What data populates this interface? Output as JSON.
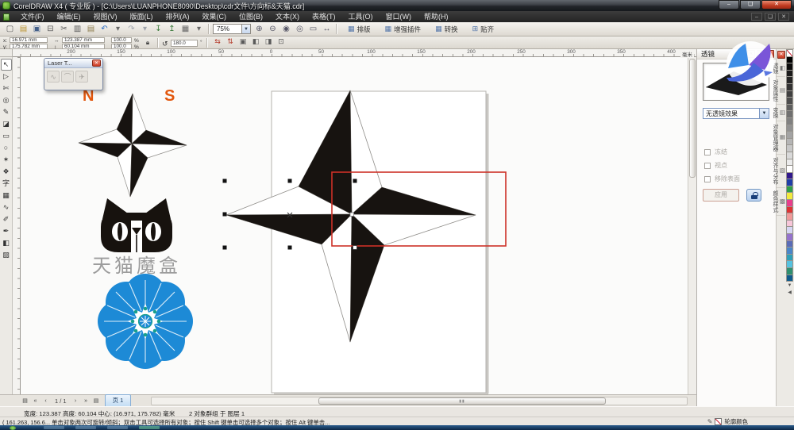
{
  "window": {
    "title": "CorelDRAW X4 ( 专业版 ) - [C:\\Users\\LUANPHONE8090\\Desktop\\cdr文件\\方向标&天猫.cdr]",
    "controls": {
      "minimize": "–",
      "maximize": "❏",
      "close": "✕"
    }
  },
  "menu": {
    "items": [
      "文件(F)",
      "编辑(E)",
      "视图(V)",
      "版面(L)",
      "排列(A)",
      "效果(C)",
      "位图(B)",
      "文本(X)",
      "表格(T)",
      "工具(O)",
      "窗口(W)",
      "帮助(H)"
    ],
    "doc_controls": [
      "‒",
      "❏",
      "✕"
    ]
  },
  "toolbar": {
    "icons": [
      {
        "name": "new-document-icon",
        "glyph": "▢",
        "color": "#5a5a5a"
      },
      {
        "name": "open-icon",
        "glyph": "▤",
        "color": "#b8912e"
      },
      {
        "name": "save-icon",
        "glyph": "▣",
        "color": "#44608a"
      },
      {
        "name": "print-icon",
        "glyph": "⊟",
        "color": "#5a5a5a"
      },
      {
        "name": "cut-icon",
        "glyph": "✂",
        "color": "#555555"
      },
      {
        "name": "copy-icon",
        "glyph": "▥",
        "color": "#555555"
      },
      {
        "name": "paste-icon",
        "glyph": "▤",
        "color": "#8a7a4a"
      },
      {
        "name": "undo-icon",
        "glyph": "↶",
        "color": "#2f6fc4"
      },
      {
        "name": "undo-dropdown-icon",
        "glyph": "▾",
        "color": "#666666"
      },
      {
        "name": "redo-icon",
        "glyph": "↷",
        "color": "#a0a5ad"
      },
      {
        "name": "redo-dropdown-icon",
        "glyph": "▾",
        "color": "#a0a5ad"
      },
      {
        "name": "import-icon",
        "glyph": "↧",
        "color": "#3a7a3a"
      },
      {
        "name": "export-icon",
        "glyph": "↥",
        "color": "#3a7a3a"
      },
      {
        "name": "application-launcher-icon",
        "glyph": "▦",
        "color": "#666666"
      },
      {
        "name": "launcher-dropdown-icon",
        "glyph": "▾",
        "color": "#666666"
      }
    ],
    "zoom_level": "75%",
    "zoom_icons": [
      {
        "name": "zoom-in-icon",
        "glyph": "⊕"
      },
      {
        "name": "zoom-out-icon",
        "glyph": "⊖"
      },
      {
        "name": "zoom-selected-icon",
        "glyph": "◉"
      },
      {
        "name": "zoom-all-objects-icon",
        "glyph": "◎"
      },
      {
        "name": "zoom-page-icon",
        "glyph": "▭"
      },
      {
        "name": "zoom-width-icon",
        "glyph": "↔"
      }
    ],
    "labeled_buttons": [
      {
        "name": "layout-button",
        "icon": "▦",
        "label": "排版"
      },
      {
        "name": "plugins-button",
        "icon": "▦",
        "label": "增强插件"
      },
      {
        "name": "convert-button",
        "icon": "▦",
        "label": "转换"
      },
      {
        "name": "snap-button",
        "icon": "⊞",
        "label": "贴齐"
      }
    ]
  },
  "property_bar": {
    "x_label": "x:",
    "x_value": "16.971 mm",
    "y_label": "y:",
    "y_value": "175.782 mm",
    "width_icon": "↔",
    "width_value": "123.387 mm",
    "height_icon": "↕",
    "height_value": "60.104 mm",
    "scale_x": "100.0",
    "scale_y": "100.0",
    "percent": "%",
    "rotate_icon": "↺",
    "rotation_value": "180.0",
    "rotation_unit": "°",
    "icons": [
      {
        "name": "mirror-horizontal-icon",
        "glyph": "⇆",
        "color": "#b33a2a"
      },
      {
        "name": "mirror-vertical-icon",
        "glyph": "⇅",
        "color": "#b33a2a"
      },
      {
        "name": "combine-icon",
        "glyph": "▣",
        "color": "#5a5a5a"
      },
      {
        "name": "weld-icon",
        "glyph": "◧",
        "color": "#5a5a5a"
      },
      {
        "name": "trim-icon",
        "glyph": "◨",
        "color": "#5a5a5a"
      },
      {
        "name": "wrap-text-icon",
        "glyph": "⊡",
        "color": "#5a5a5a"
      }
    ]
  },
  "rulers": {
    "h_numbers": [
      "200",
      "150",
      "100",
      "50",
      "0",
      "50",
      "100",
      "150",
      "200",
      "250",
      "300",
      "350",
      "400"
    ],
    "unit": "毫米"
  },
  "toolbox": {
    "tools": [
      {
        "name": "pick-tool",
        "glyph": "↖",
        "selected": true
      },
      {
        "name": "shape-tool",
        "glyph": "▷"
      },
      {
        "name": "crop-tool",
        "glyph": "✄"
      },
      {
        "name": "zoom-tool",
        "glyph": "◎"
      },
      {
        "name": "freehand-tool",
        "glyph": "✎"
      },
      {
        "name": "smart-fill-tool",
        "glyph": "◪"
      },
      {
        "name": "rectangle-tool",
        "glyph": "▭"
      },
      {
        "name": "ellipse-tool",
        "glyph": "○"
      },
      {
        "name": "polygon-tool",
        "glyph": "✶"
      },
      {
        "name": "basic-shapes-tool",
        "glyph": "❖"
      },
      {
        "name": "text-tool",
        "glyph": "字"
      },
      {
        "name": "table-tool",
        "glyph": "▦"
      },
      {
        "name": "interactive-blend-tool",
        "glyph": "∿"
      },
      {
        "name": "eyedropper-tool",
        "glyph": "✐"
      },
      {
        "name": "outline-pen-tool",
        "glyph": "✒"
      },
      {
        "name": "fill-tool",
        "glyph": "◧"
      },
      {
        "name": "interactive-fill-tool",
        "glyph": "▨"
      }
    ]
  },
  "floating_toolbar": {
    "title": "Laser T...",
    "close": "✕",
    "tools": [
      {
        "name": "laser-tool-1",
        "glyph": "∿"
      },
      {
        "name": "laser-tool-2",
        "glyph": "⌒"
      },
      {
        "name": "laser-tool-3",
        "glyph": "✈"
      }
    ]
  },
  "canvas": {
    "compass_n": "N",
    "compass_s": "S",
    "tmall_label": "天猫魔盒",
    "colors": {
      "ns_orange": "#e2570e",
      "flower_blue": "#1d8ad6",
      "flower_dot_teal": "#18a08c",
      "red_box": "#cd3127",
      "tmall_text_gray": "#9c9c9c",
      "star_black": "#171310"
    }
  },
  "docker": {
    "title": "透镜",
    "buttons": {
      "collapse": "«",
      "float": "❏",
      "close": "✕"
    },
    "dropdown_value": "无透镜效果",
    "checkboxes": [
      {
        "name": "frozen-checkbox",
        "label": "冻结"
      },
      {
        "name": "viewpoint-checkbox",
        "label": "视点"
      },
      {
        "name": "remove-face-checkbox",
        "label": "移除表面"
      }
    ],
    "apply_label": "应用",
    "tabs": [
      {
        "name": "tab-lens",
        "icon": "◧",
        "label": "透镜"
      },
      {
        "name": "tab-object-properties",
        "icon": "▤",
        "label": "对象属性"
      },
      {
        "name": "tab-transform",
        "icon": "▥",
        "label": "变换"
      },
      {
        "name": "tab-object-manager",
        "icon": "▦",
        "label": "对象管理器"
      },
      {
        "name": "tab-align-distribute",
        "icon": "▧",
        "label": "对齐与分布"
      },
      {
        "name": "tab-color-styles",
        "icon": "▩",
        "label": "颜色样式"
      }
    ]
  },
  "palette": {
    "swatches": [
      {
        "c": "#ffffff"
      },
      {
        "c": "#000000"
      },
      {
        "c": "#0d0d0d"
      },
      {
        "c": "#1a1a1a"
      },
      {
        "c": "#262626"
      },
      {
        "c": "#333333"
      },
      {
        "c": "#404040"
      },
      {
        "c": "#4d4d4d"
      },
      {
        "c": "#5e5e5e"
      },
      {
        "c": "#707070"
      },
      {
        "c": "#808080"
      },
      {
        "c": "#919191"
      },
      {
        "c": "#a3a3a3"
      },
      {
        "c": "#b5b5b5"
      },
      {
        "c": "#c7c7c7"
      },
      {
        "c": "#d9d9d9"
      },
      {
        "c": "#ebebeb"
      },
      {
        "c": "#ffffff"
      },
      {
        "c": "#31188c"
      },
      {
        "c": "#1f3ea8"
      },
      {
        "c": "#2e9e49"
      },
      {
        "c": "#f2ea3d"
      },
      {
        "c": "#e83e8c"
      },
      {
        "c": "#dd3333"
      },
      {
        "c": "#f09a9a"
      },
      {
        "c": "#f7c6d9"
      },
      {
        "c": "#d6d6f4"
      },
      {
        "c": "#9472cc"
      },
      {
        "c": "#5a6cb8"
      },
      {
        "c": "#4a86c8"
      },
      {
        "c": "#2f9fb8"
      },
      {
        "c": "#55c2e0"
      },
      {
        "c": "#2f8f6f"
      },
      {
        "c": "#0f5c8c"
      }
    ]
  },
  "page_nav": {
    "add_page_icon": "▤",
    "first": "«",
    "prev": "‹",
    "pages": "1 / 1",
    "next": "›",
    "last": "»",
    "add_page_icon_2": "▤",
    "tab": "页 1"
  },
  "status": {
    "line1_left": "宽度: 123.387 高度: 60.104 中心: (16.971, 175.782) 毫米",
    "line1_right": "2 对象群组 于 图层 1",
    "line2": "( 161.263, 156.6...  单击对象两次可旋转/倾斜；双击工具可选择所有对象；按住 Shift 键单击可选择多个对象；按住 Alt 键单击...",
    "outline_label": "轮廓颜色"
  }
}
